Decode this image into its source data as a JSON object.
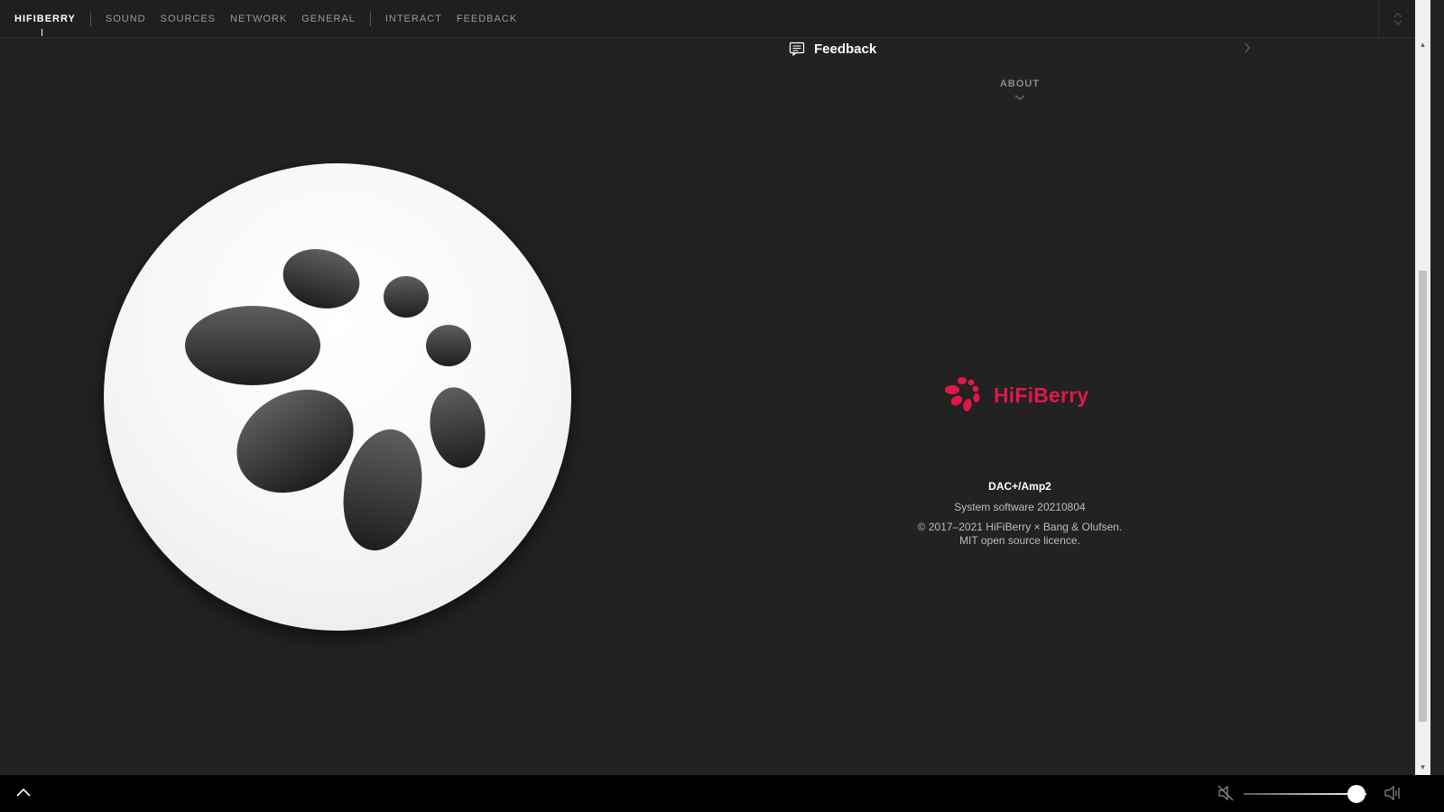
{
  "nav": {
    "items": [
      {
        "label": "HIFIBERRY",
        "active": true
      },
      {
        "label": "SOUND"
      },
      {
        "label": "SOURCES"
      },
      {
        "label": "NETWORK"
      },
      {
        "label": "GENERAL"
      },
      {
        "label": "INTERACT"
      },
      {
        "label": "FEEDBACK"
      }
    ]
  },
  "feedback_row": {
    "label": "Feedback",
    "icon": "chat-icon"
  },
  "about": {
    "heading": "ABOUT"
  },
  "brand": {
    "name": "HiFiBerry",
    "color": "#e0184a"
  },
  "info": {
    "model": "DAC+/Amp2",
    "system_software": "System software 20210804",
    "copyright_line1": "© 2017–2021 HiFiBerry × Bang & Olufsen.",
    "copyright_line2": "MIT open source licence."
  },
  "volume": {
    "level": 0.92
  },
  "colors": {
    "background": "#222222",
    "accent": "#e0184a",
    "bottom_bar": "#000000"
  }
}
